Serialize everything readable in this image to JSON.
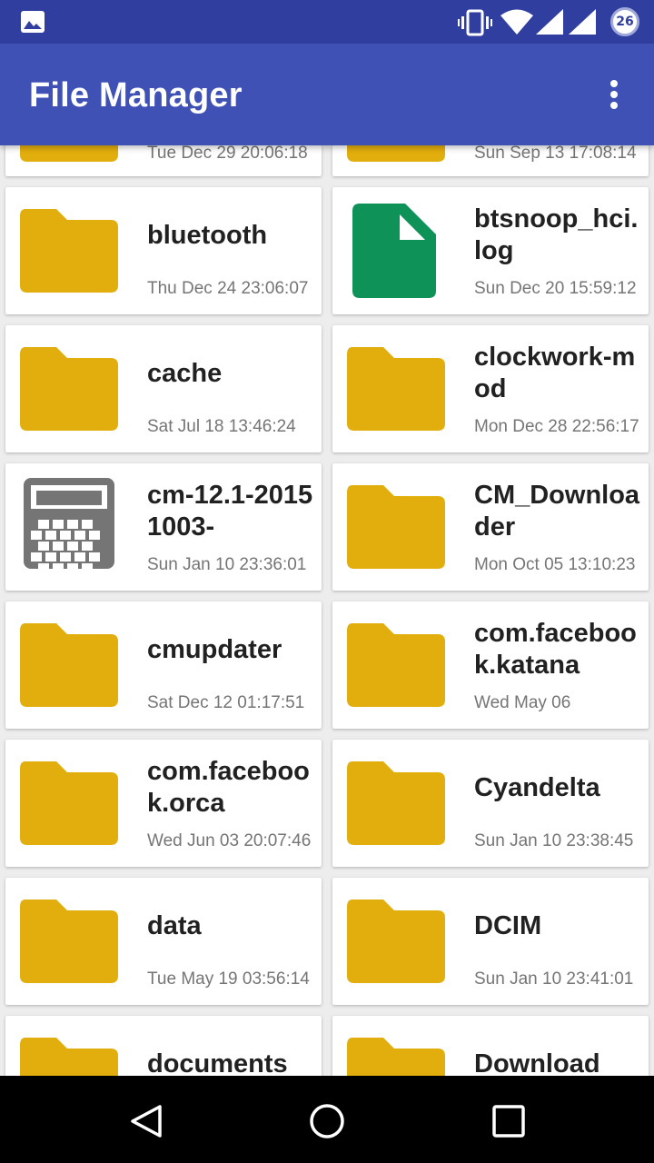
{
  "status_bar": {
    "icons": [
      "image-icon",
      "vibrate-icon",
      "wifi-icon",
      "signal-icon",
      "signal-icon"
    ],
    "battery_level": "26"
  },
  "app_bar": {
    "title": "File Manager",
    "menu_icon": "overflow-menu-icon"
  },
  "colors": {
    "status_bar": "#303f9f",
    "app_bar": "#3f51b5",
    "folder": "#e2ae0d",
    "file_green": "#0f9258",
    "archive_gray": "#757575"
  },
  "files": [
    {
      "name": "",
      "date": "Tue Dec 29 20:06:18",
      "icon": "folder-icon"
    },
    {
      "name": "",
      "date": "Sun Sep 13 17:08:14",
      "icon": "folder-icon"
    },
    {
      "name": "bluetooth",
      "date": "Thu Dec 24 23:06:07",
      "icon": "folder-icon"
    },
    {
      "name": "btsnoop_hci.log",
      "date": "Sun Dec 20 15:59:12",
      "icon": "file-icon"
    },
    {
      "name": "cache",
      "date": "Sat Jul 18 13:46:24",
      "icon": "folder-icon"
    },
    {
      "name": "clockwork-mod",
      "date": "Mon Dec 28 22:56:17",
      "icon": "folder-icon"
    },
    {
      "name": "cm-12.1-20151003-",
      "date": "Sun Jan 10 23:36:01",
      "icon": "archive-icon"
    },
    {
      "name": "CM_Downloader",
      "date": "Mon Oct 05 13:10:23",
      "icon": "folder-icon"
    },
    {
      "name": "cmupdater",
      "date": "Sat Dec 12 01:17:51",
      "icon": "folder-icon"
    },
    {
      "name": "com.facebook.katana",
      "date": "Wed May 06",
      "icon": "folder-icon"
    },
    {
      "name": "com.facebook.orca",
      "date": "Wed Jun 03 20:07:46",
      "icon": "folder-icon"
    },
    {
      "name": "Cyandelta",
      "date": "Sun Jan 10 23:38:45",
      "icon": "folder-icon"
    },
    {
      "name": "data",
      "date": "Tue May 19 03:56:14",
      "icon": "folder-icon"
    },
    {
      "name": "DCIM",
      "date": "Sun Jan 10 23:41:01",
      "icon": "folder-icon"
    },
    {
      "name": "documents",
      "date": "",
      "icon": "folder-icon"
    },
    {
      "name": "Download",
      "date": "",
      "icon": "folder-icon"
    }
  ],
  "nav_bar": {
    "back_icon": "back-icon",
    "home_icon": "home-icon",
    "recents_icon": "recents-icon"
  }
}
